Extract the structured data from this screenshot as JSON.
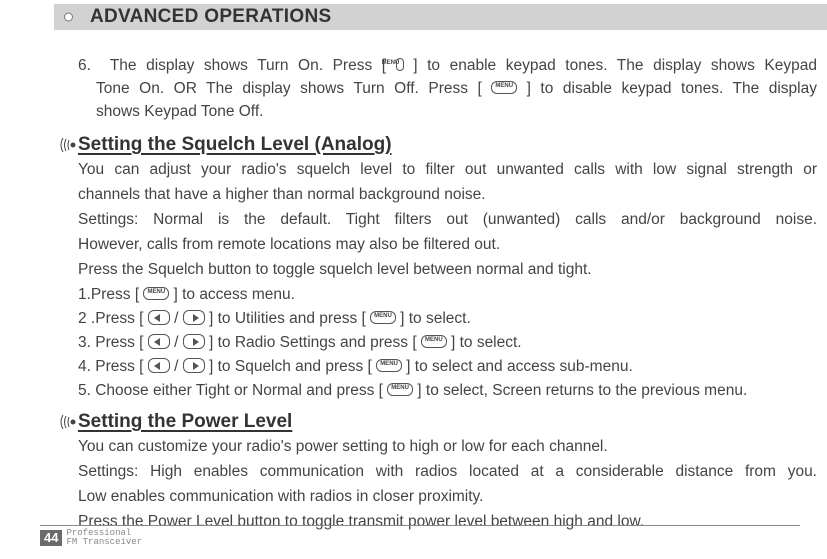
{
  "header": {
    "title": "ADVANCED OPERATIONS"
  },
  "keys": {
    "menu": "MENU"
  },
  "step6": {
    "prefix": "6.",
    "line_a_before": "The display shows Turn On. Press [",
    "line_a_after": "] to enable keypad tones. The display shows Keypad",
    "line_b_before": "Tone On. OR The display shows Turn Off. Press [",
    "line_b_after": "] to disable keypad tones. The display",
    "line_c": "shows Keypad Tone Off."
  },
  "sect_sql": {
    "title": "Setting the Squelch Level (Analog)",
    "p1_a": "You can adjust your radio's squelch level to filter out unwanted calls with low signal strength or",
    "p1_b": "channels that have a higher than normal background noise.",
    "p2_a": "Settings: Normal is the default. Tight filters out (unwanted) calls and/or background noise.",
    "p2_b": "However, calls from remote locations may also be filtered out.",
    "p3": "Press the Squelch button to toggle squelch level between normal and tight.",
    "s1_before": "1.Press [",
    "s1_after": "] to access menu.",
    "s2_before": "2 .Press [",
    "s2_mid": "] to Utilities and press [",
    "s2_after": "] to select.",
    "s3_before": "3. Press [",
    "s3_mid": "] to Radio Settings and press [",
    "s3_after": "] to select.",
    "s4_before": "4. Press [",
    "s4_mid": "] to Squelch and press [",
    "s4_after": "] to select and access sub-menu.",
    "s5_before": "5. Choose either Tight or Normal and press [",
    "s5_after": "] to select, Screen returns to the previous menu."
  },
  "sect_pwr": {
    "title": "Setting the Power Level",
    "p1": "You can customize your radio's power setting to high or low for each channel.",
    "p2_a": "Settings:  High  enables  communication  with   radios located at a considerable distance from you.",
    "p2_b": "Low enables communication with radios in closer proximity.",
    "p3": "Press the Power Level  button to toggle transmit power level between high and low."
  },
  "footer": {
    "page": "44",
    "tag1": "Professional",
    "tag2": "FM Transceiver"
  }
}
